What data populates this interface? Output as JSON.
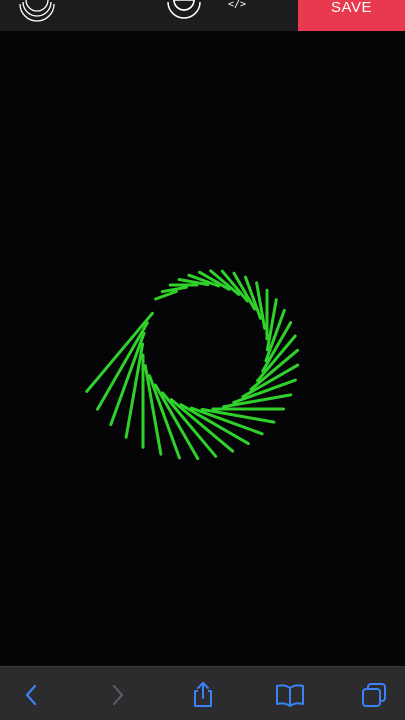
{
  "toolbar": {
    "save_label": "SAVE",
    "code_label": "</>",
    "left_icon": "layered-circle-icon",
    "center_icon": "ring-icon",
    "code_icon": "code-icon",
    "colors": {
      "background": "#1c1c1e",
      "save": "#e8394f",
      "icon": "#ffffff"
    }
  },
  "canvas": {
    "background": "#050407",
    "stroke_color": "#2fd12a",
    "pattern": "spiral-string-art",
    "line_count": 34
  },
  "browser_bar": {
    "back_icon": "chevron-left-icon",
    "forward_icon": "chevron-right-icon",
    "share_icon": "share-icon",
    "bookmarks_icon": "book-icon",
    "tabs_icon": "tabs-icon",
    "colors": {
      "background": "#2c2c2e",
      "active": "#3b82f6",
      "disabled": "#5a5a5e"
    }
  }
}
